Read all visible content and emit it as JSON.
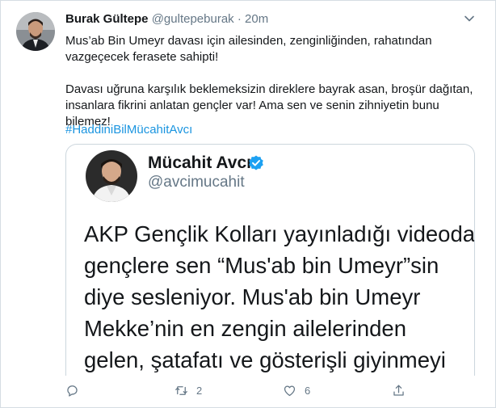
{
  "tweet": {
    "author_name": "Burak Gültepe",
    "author_handle": "@gultepeburak",
    "separator": "·",
    "time": "20m",
    "text_para1": "Mus’ab Bin Umeyr davası için ailesinden, zenginliğinden, rahatından vazgeçecek ferasete sahipti!",
    "text_para2": "Davası uğruna karşılık beklemeksizin direklere bayrak asan, broşür dağıtan, insanlara fikrini anlatan gençler var! Ama sen ve senin zihniyetin bunu bilemez!",
    "hashtag": "#HaddiniBilMücahitAvcı"
  },
  "quoted": {
    "author_name": "Mücahit Avcı",
    "author_handle": "@avcimucahit",
    "lines": [
      "AKP Gençlik Kolları yayınladığı videoda",
      "gençlere sen “Mus'ab bin Umeyr”sin",
      "diye sesleniyor. Mus'ab bin Umeyr",
      "Mekke’nin en zengin ailelerinden",
      "gelen, şatafatı ve gösterişli giyinmeyi"
    ]
  },
  "actions": {
    "reply_count": "",
    "retweet_count": "2",
    "like_count": "6"
  },
  "icons": {
    "caret": "chevron-down-icon",
    "verified": "verified-badge-icon",
    "reply": "reply-icon",
    "retweet": "retweet-icon",
    "like": "heart-icon",
    "share": "share-icon"
  },
  "colors": {
    "link": "#1b95e0",
    "muted": "#657786",
    "verified": "#1da1f2"
  }
}
